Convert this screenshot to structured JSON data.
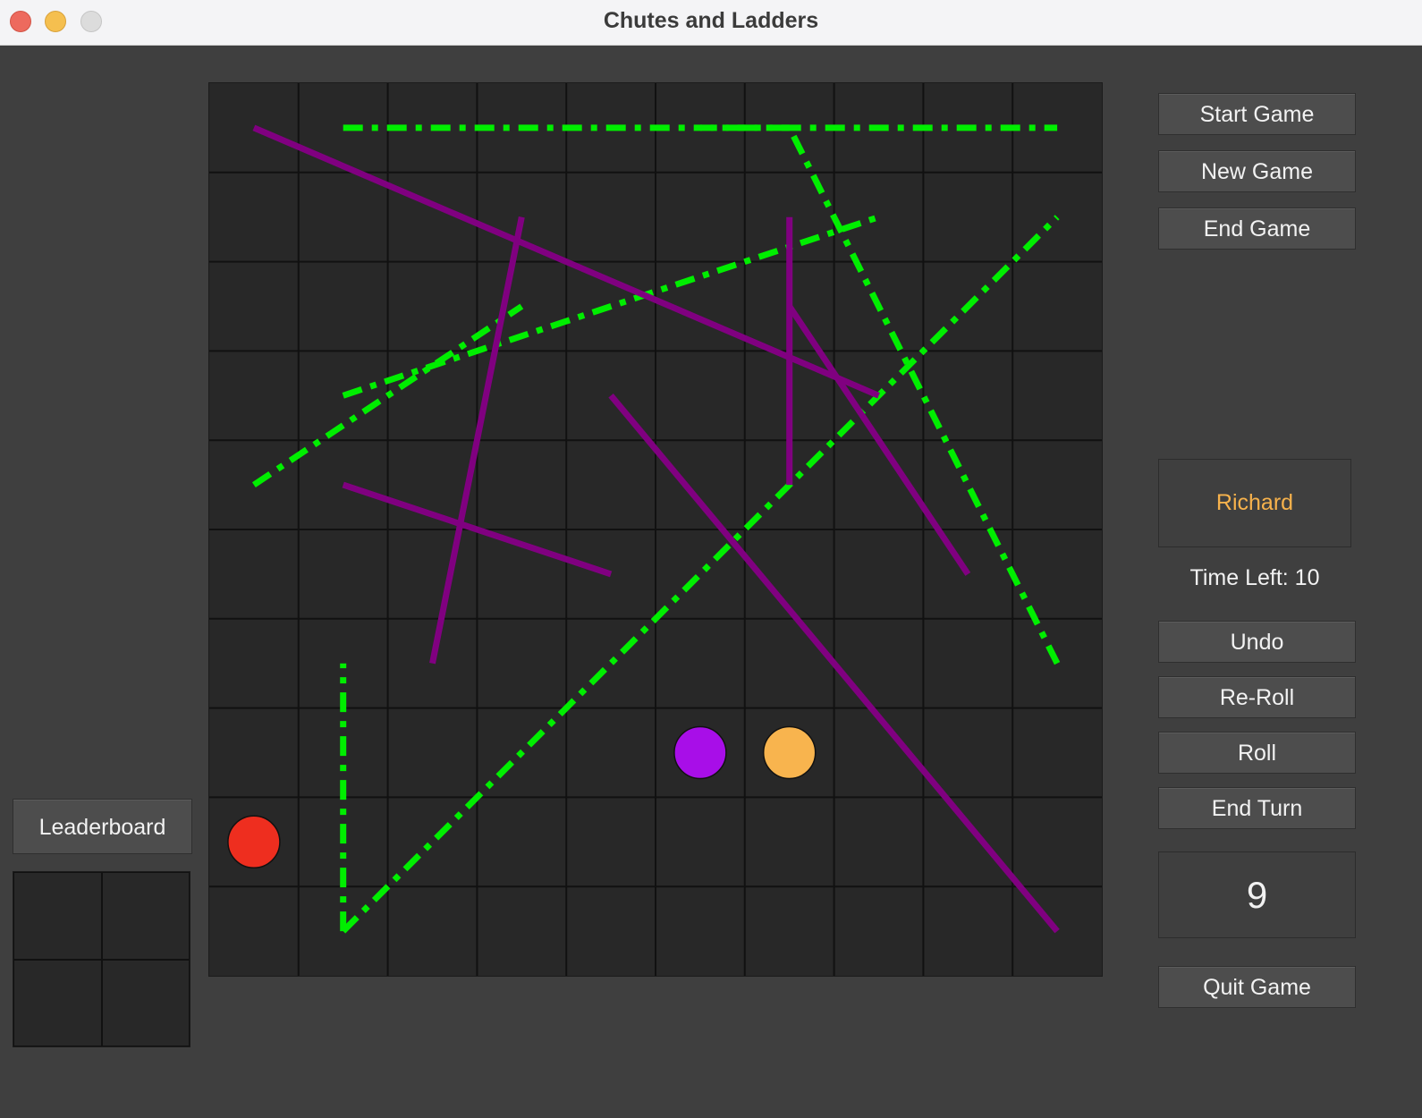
{
  "window": {
    "title": "Chutes and Ladders"
  },
  "controls": {
    "start_game": "Start Game",
    "new_game": "New Game",
    "end_game": "End Game",
    "undo": "Undo",
    "reroll": "Re-Roll",
    "roll": "Roll",
    "end_turn": "End Turn",
    "quit_game": "Quit Game"
  },
  "status": {
    "current_player": "Richard",
    "current_player_color": "#f7b24c",
    "time_left": "Time Left: 10",
    "dice_value": "9"
  },
  "leaderboard": {
    "label": "Leaderboard"
  },
  "board": {
    "grid": {
      "rows": 10,
      "cols": 10
    },
    "ladder_color": "#00ee00",
    "chute_color": "#800080",
    "ladders": [
      {
        "from": [
          1,
          0
        ],
        "to": [
          9,
          8
        ]
      },
      {
        "from": [
          1,
          0
        ],
        "to": [
          1,
          3
        ]
      },
      {
        "from": [
          0,
          5
        ],
        "to": [
          3,
          7
        ]
      },
      {
        "from": [
          1,
          6
        ],
        "to": [
          7,
          8
        ]
      },
      {
        "from": [
          1,
          9
        ],
        "to": [
          9,
          9
        ]
      },
      {
        "from": [
          6,
          9
        ],
        "to": [
          5,
          9
        ]
      },
      {
        "from": [
          9,
          3
        ],
        "to": [
          6,
          9
        ]
      }
    ],
    "chutes": [
      {
        "from": [
          7,
          6
        ],
        "to": [
          0,
          9
        ]
      },
      {
        "from": [
          2,
          3
        ],
        "to": [
          3,
          8
        ]
      },
      {
        "from": [
          4,
          4
        ],
        "to": [
          1,
          5
        ]
      },
      {
        "from": [
          8,
          4
        ],
        "to": [
          6,
          7
        ]
      },
      {
        "from": [
          6,
          5
        ],
        "to": [
          6,
          8
        ]
      },
      {
        "from": [
          9,
          0
        ],
        "to": [
          4,
          6
        ]
      }
    ],
    "tokens": [
      {
        "name": "red",
        "color": "#ee2e1f",
        "col": 0,
        "row": 1
      },
      {
        "name": "purple",
        "color": "#a80ee8",
        "col": 5,
        "row": 2
      },
      {
        "name": "orange",
        "color": "#f8b44e",
        "col": 6,
        "row": 2
      }
    ]
  }
}
